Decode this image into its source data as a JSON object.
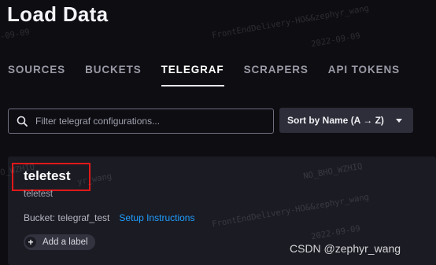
{
  "page": {
    "title": "Load Data"
  },
  "tabs": [
    {
      "label": "SOURCES"
    },
    {
      "label": "BUCKETS"
    },
    {
      "label": "TELEGRAF",
      "active": true
    },
    {
      "label": "SCRAPERS"
    },
    {
      "label": "API TOKENS"
    }
  ],
  "search": {
    "placeholder": "Filter telegraf configurations...",
    "value": ""
  },
  "sort": {
    "label": "Sort by Name (A → Z)"
  },
  "config": {
    "name": "teletest",
    "description": "teletest",
    "bucket": "Bucket: telegraf_test",
    "setup_link": "Setup Instructions",
    "add_label": "Add a label"
  },
  "watermarks": {
    "user": "FrontEndDelivery-HO&&zephyr_wang",
    "date": "2022-09-09",
    "date_short": "-09-09",
    "id": "NO_BHO_WZHIQ",
    "id_short": "O_WZHIQ",
    "user_short": "yr_wang"
  },
  "footer": {
    "csdn": "CSDN @zephyr_wang"
  },
  "colors": {
    "accent_link": "#1e9fff",
    "highlight_box": "#e01818",
    "background": "#0d0d12",
    "card": "#1b1b24"
  }
}
